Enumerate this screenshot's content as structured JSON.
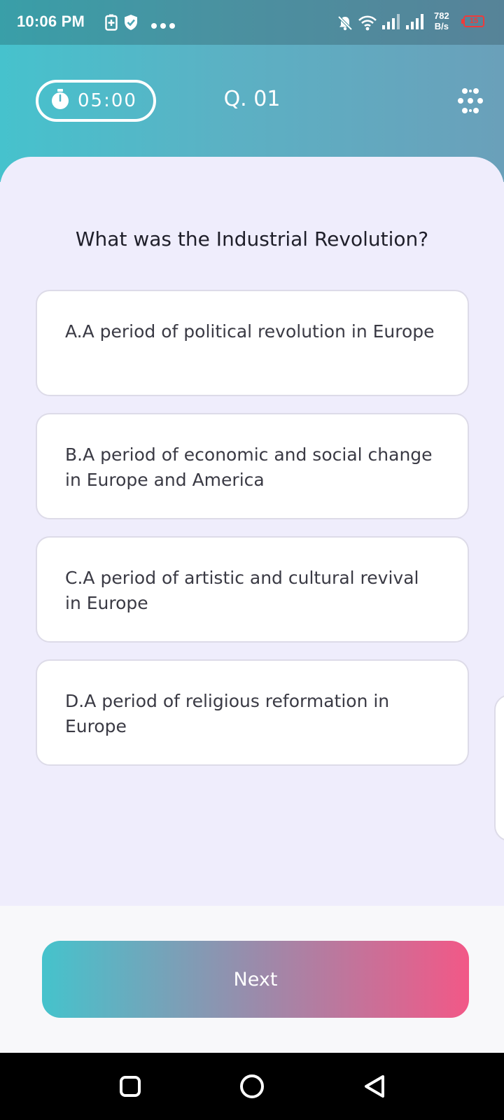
{
  "status_bar": {
    "time": "10:06 PM",
    "net_speed_value": "782",
    "net_speed_unit": "B/s",
    "battery_level": "15",
    "icons": [
      "battery-saver-icon",
      "shield-check-icon",
      "more-dots-icon",
      "bell-off-icon",
      "wifi-icon",
      "signal-icon",
      "signal-icon",
      "battery-icon"
    ]
  },
  "header": {
    "timer": "05:00",
    "question_number": "Q. 01",
    "timer_icon": "stopwatch-icon",
    "menu_icon": "grid-dots-icon"
  },
  "question": {
    "text": "What was the Industrial Revolution?",
    "options": [
      {
        "label": "A.A period of political revolution in Europe"
      },
      {
        "label": "B.A period of economic and social change in Europe and America"
      },
      {
        "label": "C.A period of artistic and cultural revival in Europe"
      },
      {
        "label": "D.A period of religious reformation in Europe"
      }
    ]
  },
  "footer": {
    "next_label": "Next"
  },
  "colors": {
    "header_gradient_start": "#46c2cd",
    "header_gradient_end": "#6aa0ba",
    "card_background": "#efedfc",
    "next_gradient_start": "#45c3cc",
    "next_gradient_end": "#f25887",
    "battery_low": "#f03a3a"
  },
  "nav_bar": {
    "icons": [
      "recents-square-icon",
      "home-circle-icon",
      "back-triangle-icon"
    ]
  }
}
